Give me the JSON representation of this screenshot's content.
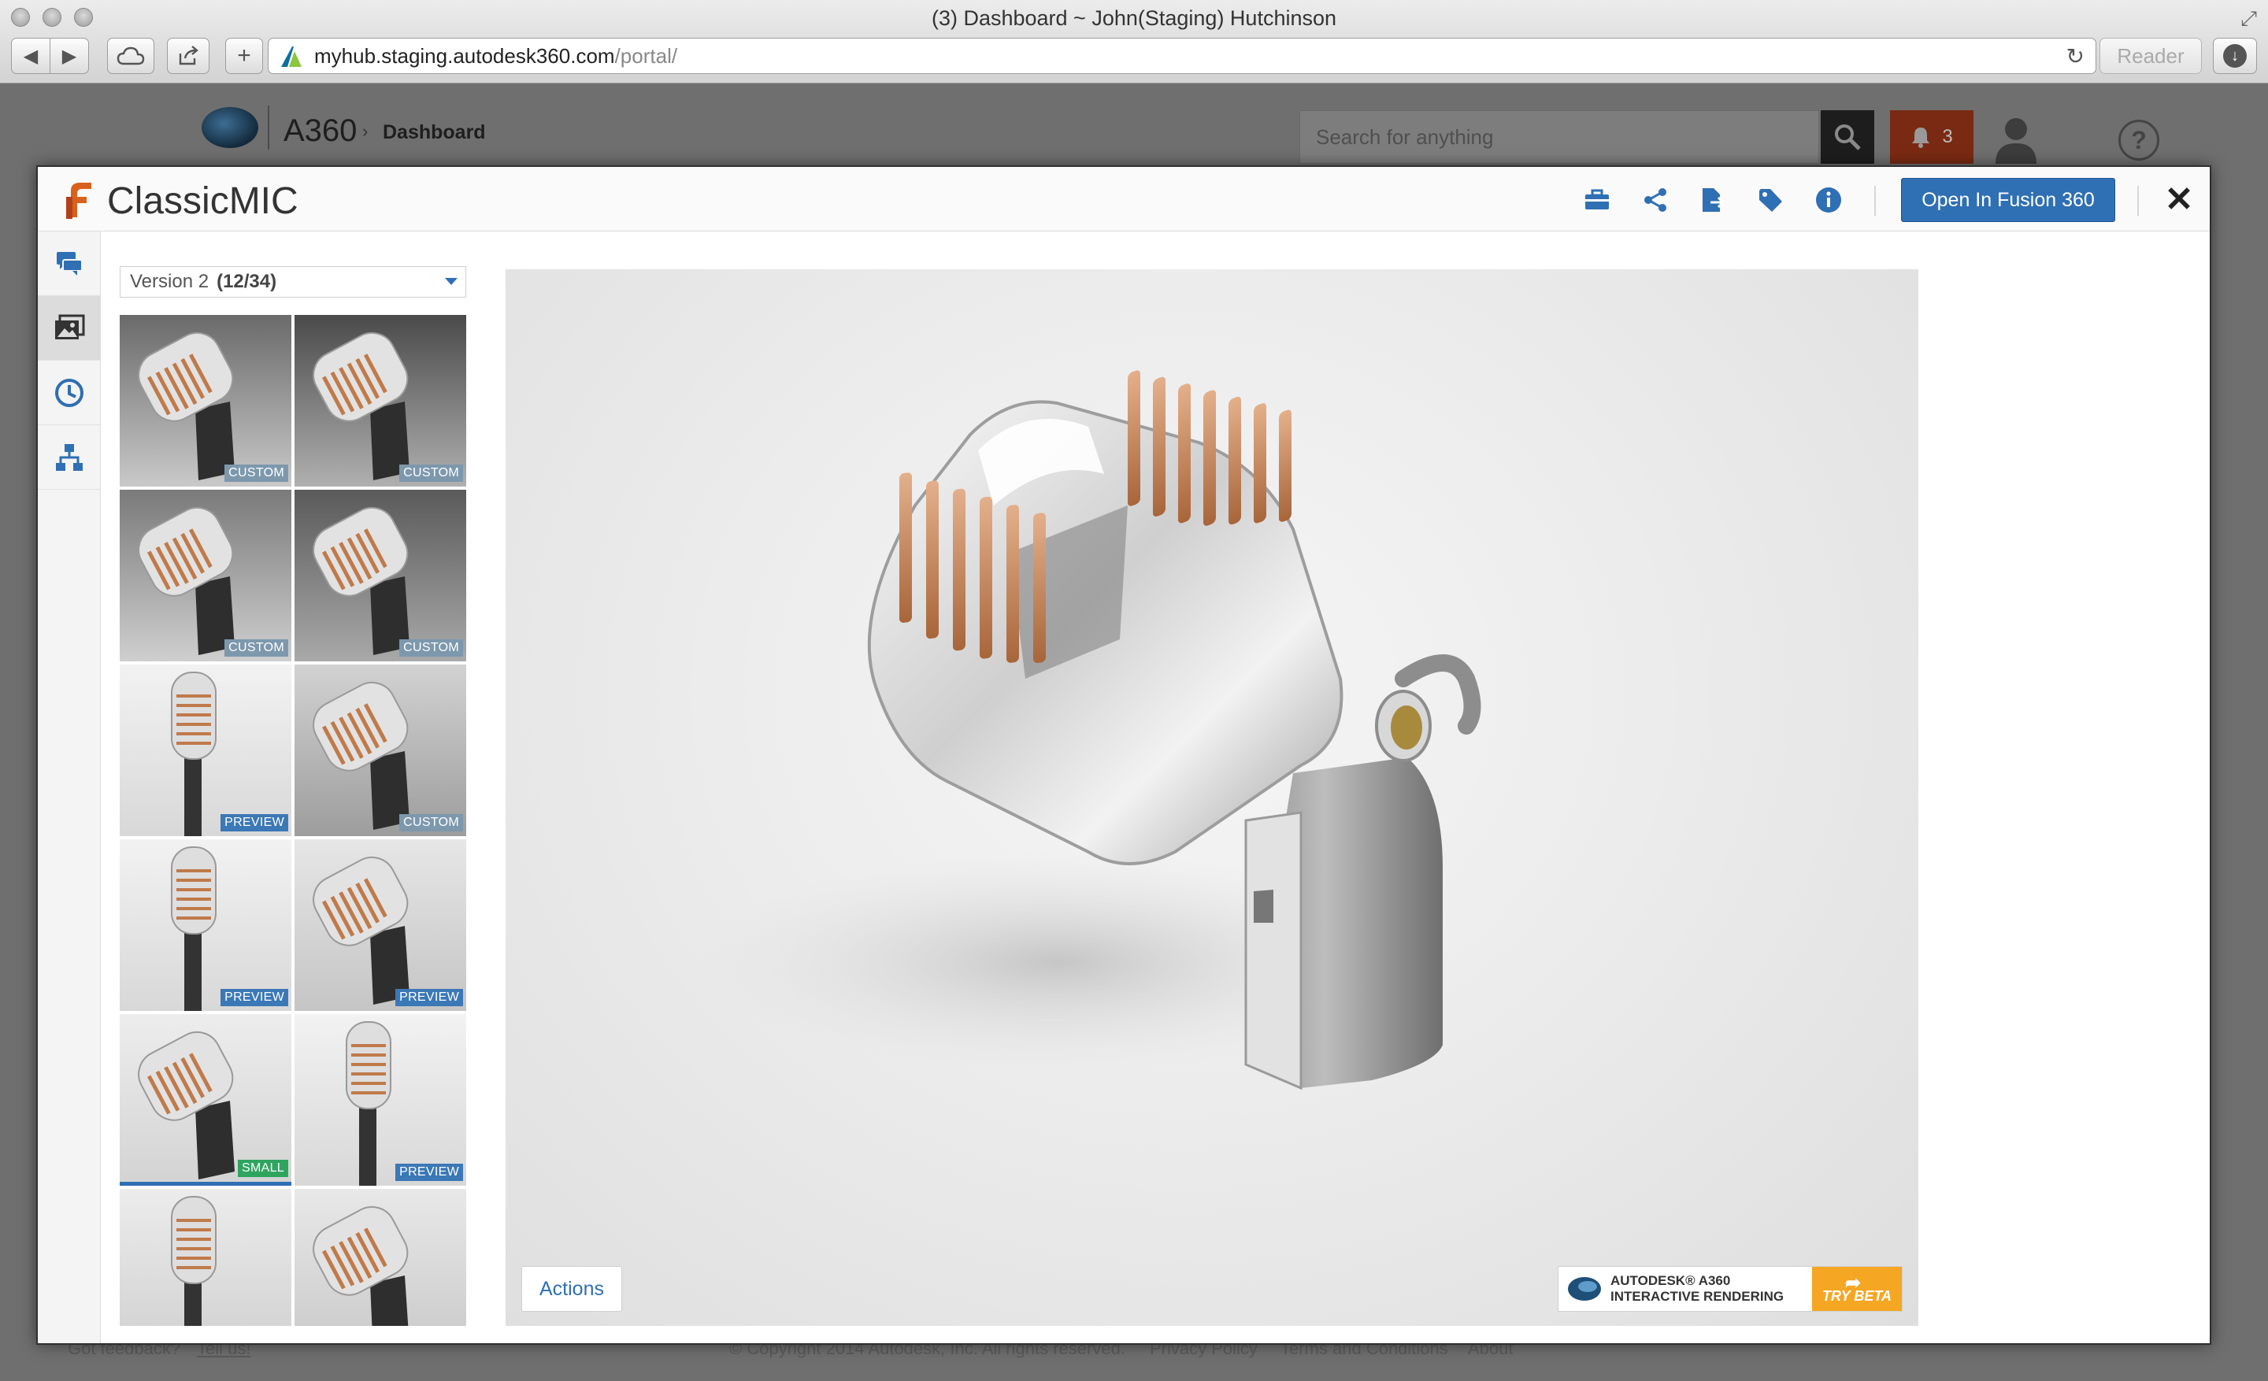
{
  "browser": {
    "window_title": "(3) Dashboard ~ John(Staging) Hutchinson",
    "url_host": "myhub.staging.autodesk360.com",
    "url_path": "/portal/",
    "reader_label": "Reader",
    "back_glyph": "◀",
    "forward_glyph": "▶",
    "new_tab_glyph": "+",
    "reload_glyph": "↻"
  },
  "app_header": {
    "app_name": "A360",
    "breadcrumb_sep": "›",
    "breadcrumb": "Dashboard",
    "search_placeholder": "Search for anything",
    "notification_count": "3",
    "help_glyph": "?"
  },
  "footer": {
    "feedback": "Got feedback?",
    "tell_us": "Tell us!",
    "copyright": "© Copyright 2014 Autodesk, Inc. All rights reserved.",
    "privacy": "Privacy Policy",
    "terms": "Terms and Conditions",
    "about": "About"
  },
  "modal": {
    "title": "ClassicMIC",
    "open_button": "Open In Fusion 360",
    "close_glyph": "✕",
    "header_icons": [
      "briefcase-icon",
      "share-icon",
      "export-document-icon",
      "tag-icon",
      "info-icon"
    ],
    "rail_items": [
      "comments-icon",
      "gallery-icon",
      "history-icon",
      "hierarchy-icon"
    ],
    "active_rail_item": "gallery-icon"
  },
  "gallery": {
    "version_label": "Version 2",
    "version_count": "(12/34)",
    "thumbnails": [
      {
        "tag": "CUSTOM",
        "tag_type": "custom"
      },
      {
        "tag": "CUSTOM",
        "tag_type": "custom"
      },
      {
        "tag": "CUSTOM",
        "tag_type": "custom"
      },
      {
        "tag": "CUSTOM",
        "tag_type": "custom"
      },
      {
        "tag": "PREVIEW",
        "tag_type": "preview"
      },
      {
        "tag": "CUSTOM",
        "tag_type": "custom"
      },
      {
        "tag": "PREVIEW",
        "tag_type": "preview"
      },
      {
        "tag": "PREVIEW",
        "tag_type": "preview"
      },
      {
        "tag": "SMALL",
        "tag_type": "small",
        "selected": true
      },
      {
        "tag": "PREVIEW",
        "tag_type": "preview"
      },
      {
        "tag": "",
        "tag_type": "none"
      },
      {
        "tag": "",
        "tag_type": "none"
      }
    ]
  },
  "viewer": {
    "actions_label": "Actions",
    "promo_line1": "AUTODESK® A360",
    "promo_line2": "INTERACTIVE RENDERING",
    "promo_cta": "TRY BETA"
  },
  "colors": {
    "accent_blue": "#2f6fb3",
    "tag_custom": "#7d98ad",
    "tag_preview": "#3b78b6",
    "tag_small": "#2fa45f",
    "promo_orange": "#f5a623",
    "notification_red": "#7a2a12"
  }
}
